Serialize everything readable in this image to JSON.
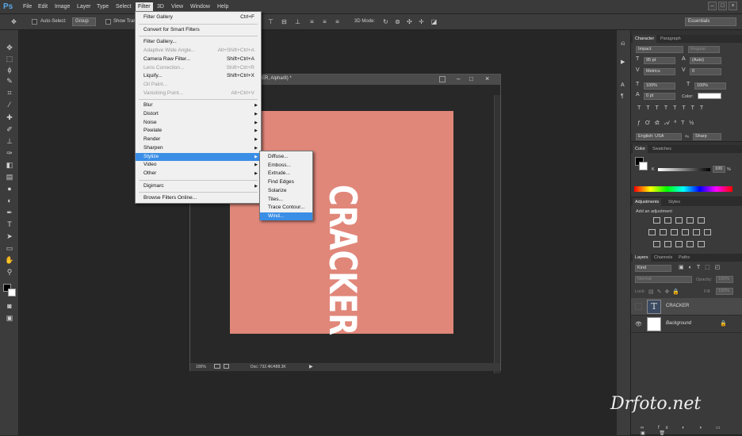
{
  "app": {
    "logo": "Ps"
  },
  "menubar": {
    "items": [
      "File",
      "Edit",
      "Image",
      "Layer",
      "Type",
      "Select",
      "Filter",
      "3D",
      "View",
      "Window",
      "Help"
    ],
    "active": "Filter"
  },
  "options": {
    "auto_select": "Auto-Select:",
    "auto_select_value": "Group",
    "show_transform": "Show Trans",
    "mode_3d": "3D Mode:",
    "workspace": "Essentials"
  },
  "filter_menu": {
    "items": [
      {
        "label": "Filter Gallery",
        "shortcut": "Ctrl+F",
        "disabled": false
      },
      {
        "sep": true
      },
      {
        "label": "Convert for Smart Filters",
        "shortcut": "",
        "disabled": false
      },
      {
        "sep": true
      },
      {
        "label": "Filter Gallery...",
        "shortcut": "",
        "disabled": false
      },
      {
        "label": "Adaptive Wide Angle...",
        "shortcut": "Alt+Shift+Ctrl+A",
        "disabled": true
      },
      {
        "label": "Camera Raw Filter...",
        "shortcut": "Shift+Ctrl+A",
        "disabled": false
      },
      {
        "label": "Lens Correction...",
        "shortcut": "Shift+Ctrl+R",
        "disabled": true
      },
      {
        "label": "Liquify...",
        "shortcut": "Shift+Ctrl+X",
        "disabled": false
      },
      {
        "label": "Oil Paint...",
        "shortcut": "",
        "disabled": true
      },
      {
        "label": "Vanishing Point...",
        "shortcut": "Alt+Ctrl+V",
        "disabled": true
      },
      {
        "sep": true
      },
      {
        "label": "Blur",
        "submenu": true
      },
      {
        "label": "Distort",
        "submenu": true
      },
      {
        "label": "Noise",
        "submenu": true
      },
      {
        "label": "Pixelate",
        "submenu": true
      },
      {
        "label": "Render",
        "submenu": true
      },
      {
        "label": "Sharpen",
        "submenu": true
      },
      {
        "label": "Stylize",
        "submenu": true,
        "highlight": true
      },
      {
        "label": "Video",
        "submenu": true
      },
      {
        "label": "Other",
        "submenu": true
      },
      {
        "sep": true
      },
      {
        "label": "Digimarc",
        "submenu": true
      },
      {
        "sep": true
      },
      {
        "label": "Browse Filters Online...",
        "shortcut": "",
        "disabled": false
      }
    ]
  },
  "stylize_menu": {
    "items": [
      "Diffuse...",
      "Emboss...",
      "Extrude...",
      "Find Edges",
      "Solarize",
      "Tiles...",
      "Trace Contour...",
      "Wind..."
    ],
    "highlight": "Wind..."
  },
  "document": {
    "title": "ER, Alpha/8) *",
    "canvas_color": "#e0877a",
    "text": "CRACKER",
    "zoom": "100%",
    "doc_size": "Doc: 732.4K/488.3K"
  },
  "character_panel": {
    "tabs": [
      "Character",
      "Paragraph"
    ],
    "font": "Impact",
    "style": "Regular",
    "size": "95 pt",
    "leading": "(Auto)",
    "kerning": "Metrics",
    "tracking": "0",
    "vscale": "100%",
    "hscale": "100%",
    "baseline": "0 pt",
    "color_label": "Color:",
    "language": "English: USA",
    "antialias": "Sharp"
  },
  "color_panel": {
    "tabs": [
      "Color",
      "Swatches"
    ],
    "channel": "K",
    "value": "100",
    "unit": "%"
  },
  "adjustments_panel": {
    "tabs": [
      "Adjustments",
      "Styles"
    ],
    "heading": "Add an adjustment"
  },
  "layers_panel": {
    "tabs": [
      "Layers",
      "Channels",
      "Paths"
    ],
    "filter": "Kind",
    "blend": "Normal",
    "opacity_label": "Opacity:",
    "opacity": "100%",
    "lock_label": "Lock:",
    "fill_label": "Fill:",
    "fill": "100%",
    "layers": [
      {
        "name": "CRACKER",
        "type": "text",
        "selected": true
      },
      {
        "name": "Background",
        "type": "bg",
        "selected": false
      }
    ]
  },
  "watermark": "Drfoto.net"
}
